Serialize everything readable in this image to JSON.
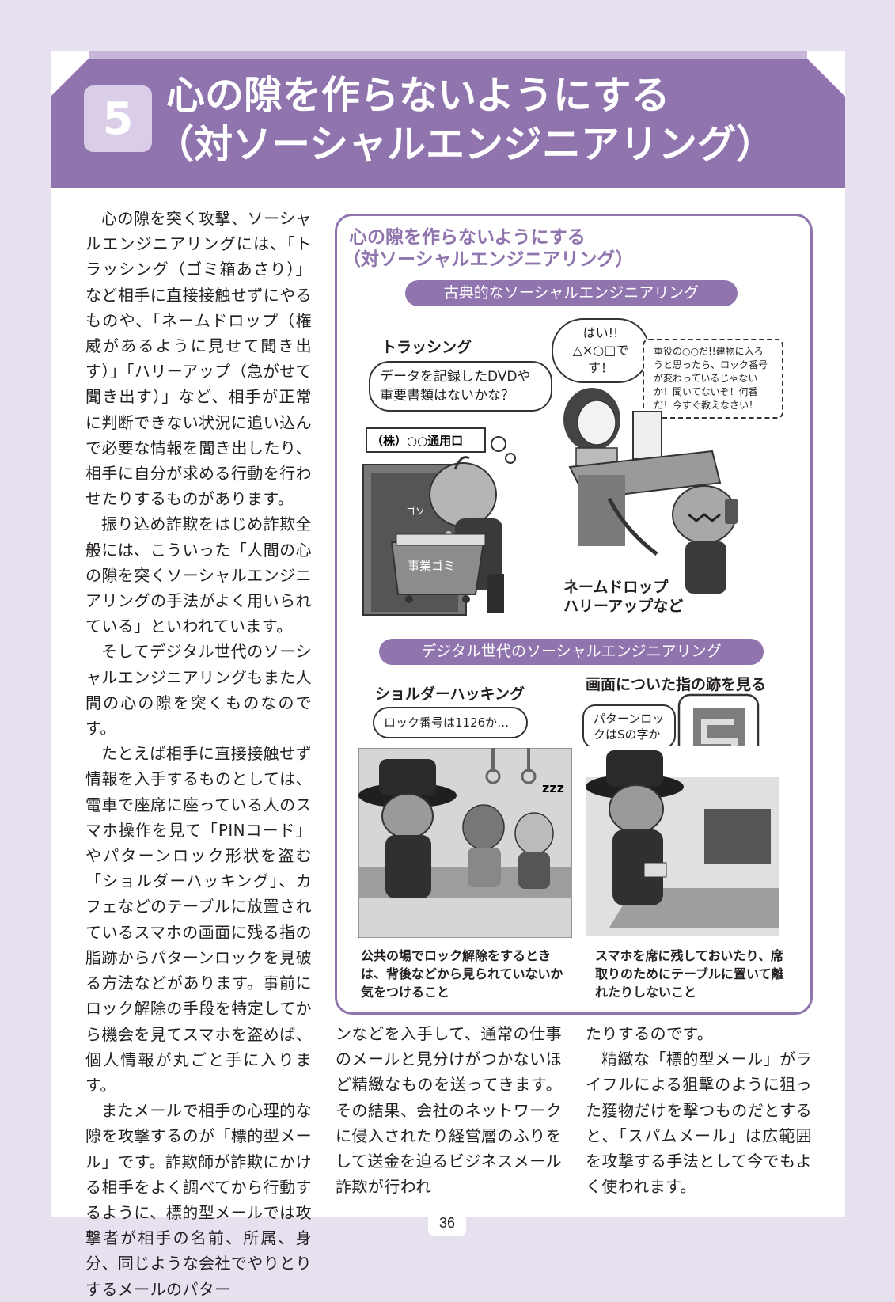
{
  "header": {
    "number": "5",
    "title_line1": "心の隙を作らないようにする",
    "title_line2": "（対ソーシャルエンジニアリング）"
  },
  "body": {
    "col1": [
      "心の隙を突く攻撃、ソーシャルエンジニアリングには、「トラッシング（ゴミ箱あさり）」など相手に直接接触せずにやるものや、「ネームドロップ（権威があるように見せて聞き出す）」「ハリーアップ（急がせて聞き出す）」など、相手が正常に判断できない状況に追い込んで必要な情報を聞き出したり、相手に自分が求める行動を行わせたりするものがあります。",
      "振り込め詐欺をはじめ詐欺全般には、こういった「人間の心の隙を突くソーシャルエンジニアリングの手法がよく用いられている」といわれています。",
      "そしてデジタル世代のソーシャルエンジニアリングもまた人間の心の隙を突くものなのです。",
      "たとえば相手に直接接触せず情報を入手するものとしては、電車で座席に座っている人のスマホ操作を見て「PINコード」やパターンロック形状を盗む「ショルダーハッキング」、カフェなどのテーブルに放置されているスマホの画面に残る指の脂跡からパターンロックを見破る方法などがあります。事前にロック解除の手段を特定してから機会を見てスマホを盗めば、個人情報が丸ごと手に入ります。",
      "またメールで相手の心理的な隙を攻撃するのが「標的型メール」です。詐欺師が詐欺にかける相手をよく調べてから行動するように、標的型メールでは攻撃者が相手の名前、所属、身分、同じような会社でやりとりするメールのパター"
    ],
    "col2": "ンなどを入手して、通常の仕事のメールと見分けがつかないほど精緻なものを送ってきます。その結果、会社のネットワークに侵入されたり経営層のふりをして送金を迫るビジネスメール詐欺が行われ",
    "col3": [
      "たりするのです。",
      "精緻な「標的型メール」がライフルによる狙撃のように狙った獲物だけを撃つものだとすると、「スパムメール」は広範囲を攻撃する手法として今でもよく使われます。"
    ]
  },
  "panel": {
    "title_line1": "心の隙を作らないようにする",
    "title_line2": "（対ソーシャルエンジニアリング）",
    "section1": "古典的なソーシャルエンジニアリング",
    "trashing_label": "トラッシング",
    "trashing_bubble": "データを記録したDVDや重要書類はないかな？",
    "company_sign": "（株）○○通用口",
    "sfx": "ゴソ",
    "trash_label": "事業ゴミ",
    "answer_bubble_1": "はい!!",
    "answer_bubble_2": "△×○□です！",
    "demand_bubble": "重役の○○だ!!建物に入ろうと思ったら、ロック番号が変わっているじゃないか！聞いてないぞ！何番だ！今すぐ教えなさい！",
    "namedrop_label_1": "ネームドロップ",
    "namedrop_label_2": "ハリーアップなど",
    "section2": "デジタル世代のソーシャルエンジニアリング",
    "shoulder_label": "ショルダーハッキング",
    "shoulder_bubble": "ロック番号は1126か…",
    "finger_label": "画面についた指の跡を見る",
    "finger_bubble": "パターンロックはSの字か",
    "snore": "zzz",
    "caption_left": "公共の場でロック解除をするときは、背後などから見られていないか気をつけること",
    "caption_right": "スマホを席に残しておいたり、席取りのためにテーブルに置いて離れたりしないこと"
  },
  "page_number": "36"
}
